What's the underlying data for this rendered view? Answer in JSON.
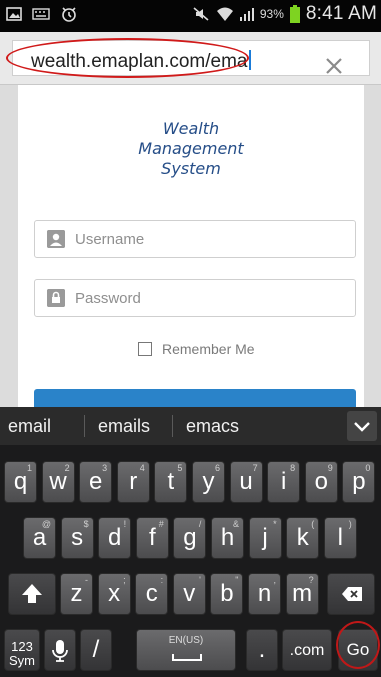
{
  "status_bar": {
    "battery": "93%",
    "time": "8:41 AM",
    "icons": [
      "image-icon",
      "keyboard-icon",
      "alarm-icon",
      "mute-icon",
      "wifi-icon",
      "signal-icon",
      "battery-icon"
    ]
  },
  "browser": {
    "url": "wealth.emaplan.com/ema",
    "clear_icon": "close-icon"
  },
  "login_page": {
    "brand_line1": "Wealth",
    "brand_line2": "Management",
    "brand_line3": "System",
    "username_placeholder": "Username",
    "password_placeholder": "Password",
    "remember_label": "Remember Me"
  },
  "suggestions": {
    "items": [
      "email",
      "emails",
      "emacs"
    ]
  },
  "keyboard": {
    "row1": [
      {
        "key": "q",
        "sec": "1"
      },
      {
        "key": "w",
        "sec": "2"
      },
      {
        "key": "e",
        "sec": "3"
      },
      {
        "key": "r",
        "sec": "4"
      },
      {
        "key": "t",
        "sec": "5"
      },
      {
        "key": "y",
        "sec": "6"
      },
      {
        "key": "u",
        "sec": "7"
      },
      {
        "key": "i",
        "sec": "8"
      },
      {
        "key": "o",
        "sec": "9"
      },
      {
        "key": "p",
        "sec": "0"
      }
    ],
    "row2": [
      {
        "key": "a",
        "sec": "@"
      },
      {
        "key": "s",
        "sec": "$"
      },
      {
        "key": "d",
        "sec": "!"
      },
      {
        "key": "f",
        "sec": "#"
      },
      {
        "key": "g",
        "sec": "/"
      },
      {
        "key": "h",
        "sec": "&"
      },
      {
        "key": "j",
        "sec": "*"
      },
      {
        "key": "k",
        "sec": "("
      },
      {
        "key": "l",
        "sec": ")"
      }
    ],
    "row3": [
      {
        "key": "z",
        "sec": "-"
      },
      {
        "key": "x",
        "sec": ";"
      },
      {
        "key": "c",
        "sec": ":"
      },
      {
        "key": "v",
        "sec": "'"
      },
      {
        "key": "b",
        "sec": "\""
      },
      {
        "key": "n",
        "sec": ","
      },
      {
        "key": "m",
        "sec": "?"
      }
    ],
    "sym_label_1": "123",
    "sym_label_2": "Sym",
    "slash_label": "/",
    "space_label": "EN(US)",
    "period_label": ".",
    "dotcom_label": ".com",
    "go_label": "Go"
  },
  "colors": {
    "annotation_red": "#d01a1a",
    "brand_blue": "#264e88",
    "accent_blue": "#2a83c9"
  }
}
